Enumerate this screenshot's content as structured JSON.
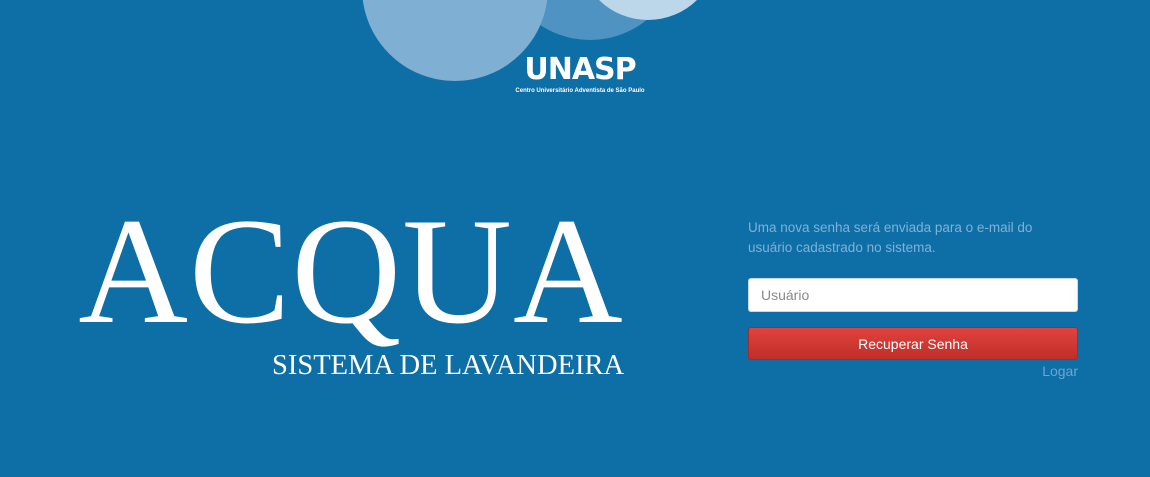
{
  "logo": {
    "word": "UNASP",
    "subtitle": "Centro Universitário Adventista de São Paulo"
  },
  "brand": {
    "title": "ACQUA",
    "subtitle": "SISTEMA DE LAVANDEIRA"
  },
  "recover": {
    "info": "Uma nova senha será enviada para o e-mail do usuário cadastrado no sistema.",
    "username_placeholder": "Usuário",
    "username_value": "",
    "button_label": "Recuperar Senha",
    "login_link": "Logar"
  },
  "colors": {
    "background": "#0e6ea6",
    "button": "#d63a35",
    "info_text": "#7fb2d9"
  }
}
